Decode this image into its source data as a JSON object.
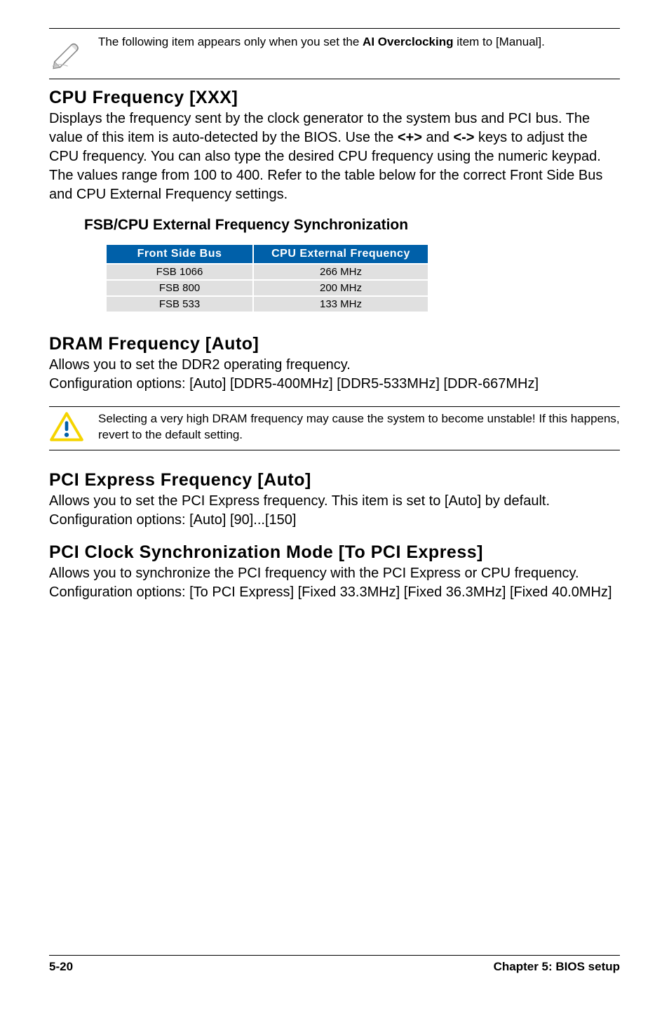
{
  "note": {
    "text_pre": "The following item appears only when you set the ",
    "bold": "AI Overclocking",
    "text_post": " item to [Manual]."
  },
  "sec1": {
    "title": "CPU Frequency [XXX]",
    "body_pre": "Displays the frequency sent by the clock generator to the system bus and PCI bus. The value of this item is auto-detected by the BIOS. Use the ",
    "kb1": "<+>",
    "body_mid": " and ",
    "kb2": "<->",
    "body_post": " keys to adjust the CPU frequency. You can also type the desired CPU frequency using the numeric keypad. The values range from 100 to 400. Refer to the table below for the correct Front Side Bus and CPU External Frequency settings."
  },
  "table": {
    "heading": "FSB/CPU External Frequency Synchronization",
    "col1": "Front Side Bus",
    "col2": "CPU External Frequency",
    "rows": [
      {
        "c1": "FSB 1066",
        "c2": "266 MHz"
      },
      {
        "c1": "FSB 800",
        "c2": "200 MHz"
      },
      {
        "c1": "FSB 533",
        "c2": "133 MHz"
      }
    ]
  },
  "sec2": {
    "title": "DRAM Frequency [Auto]",
    "body": "Allows you to set the DDR2 operating frequency.\nConfiguration options: [Auto] [DDR5-400MHz] [DDR5-533MHz] [DDR-667MHz]"
  },
  "caution": {
    "text": "Selecting a very high DRAM frequency may cause the system to become unstable! If this happens, revert to the default setting."
  },
  "sec3": {
    "title": "PCI Express Frequency [Auto]",
    "body": "Allows you to set the PCI Express frequency. This item is set to [Auto] by default. Configuration options: [Auto] [90]...[150]"
  },
  "sec4": {
    "title": "PCI Clock Synchronization Mode [To PCI Express]",
    "body": "Allows you to synchronize the PCI frequency with the PCI Express or CPU frequency. Configuration options: [To PCI Express] [Fixed 33.3MHz] [Fixed 36.3MHz] [Fixed 40.0MHz]"
  },
  "footer": {
    "left": "5-20",
    "right": "Chapter 5: BIOS setup"
  }
}
